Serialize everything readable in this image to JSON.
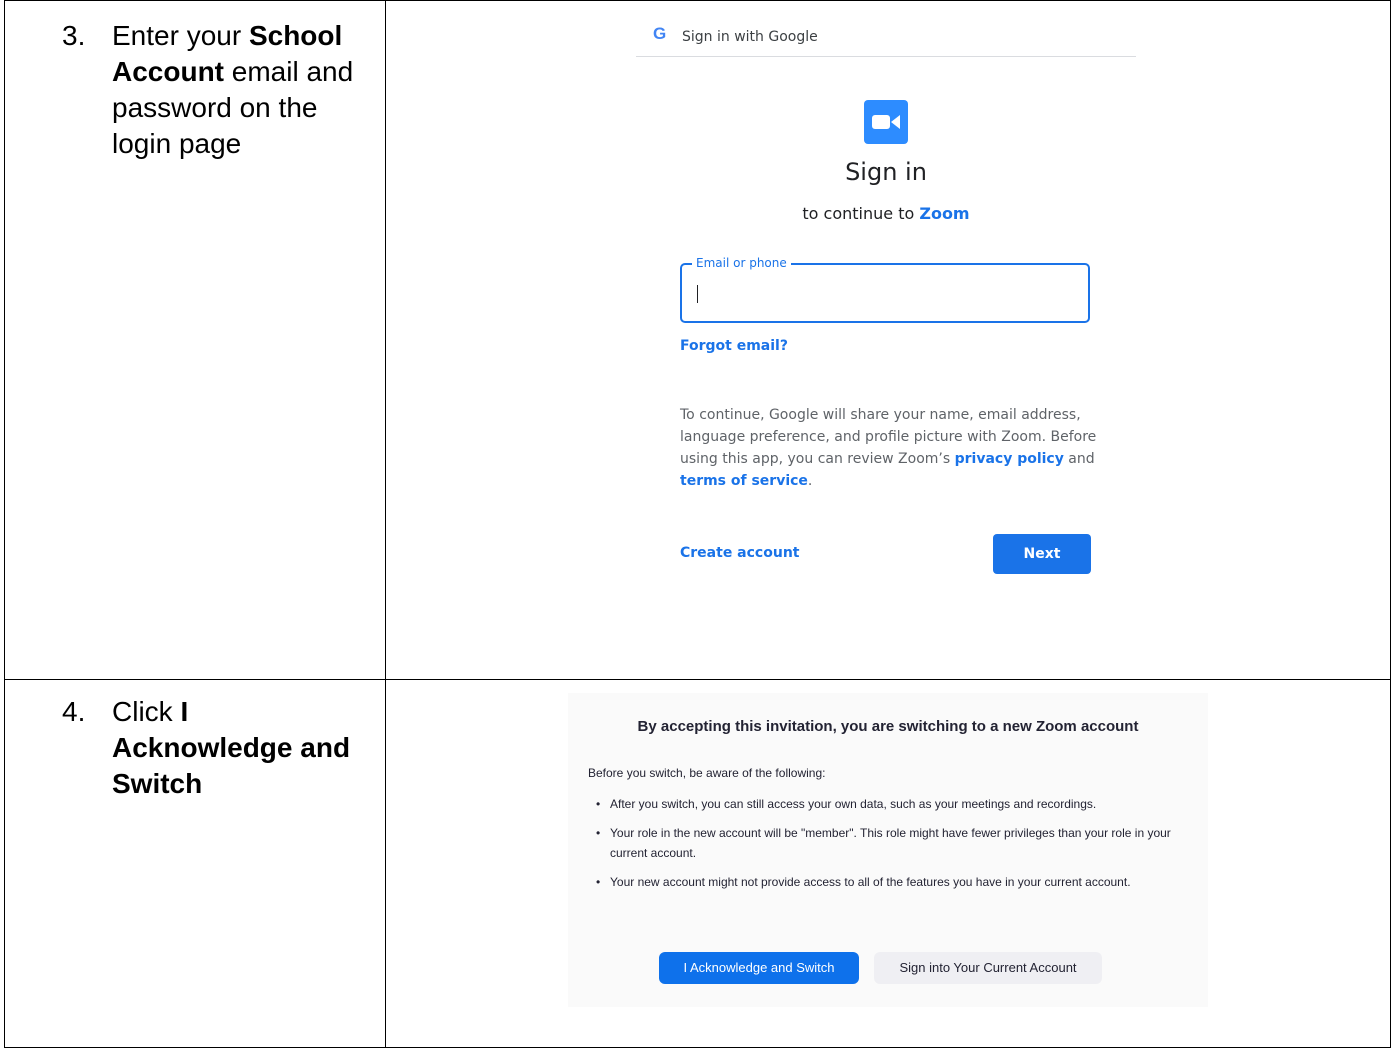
{
  "steps": [
    {
      "number": "3.",
      "parts": [
        "Enter your ",
        "School Account",
        " email and password on the login page"
      ]
    },
    {
      "number": "4.",
      "parts": [
        "Click ",
        "I Acknowledge and Switch"
      ]
    }
  ],
  "google": {
    "logo": "G",
    "header": "Sign in with Google",
    "title": "Sign in",
    "subtitle_prefix": "to continue to ",
    "subtitle_app": "Zoom",
    "email_label": "Email or phone",
    "forgot": "Forgot email?",
    "consent_1": "To continue, Google will share your name, email address, language preference, and profile picture with Zoom. Before using this app, you can review Zoom’s ",
    "privacy": "privacy policy",
    "consent_2": " and ",
    "terms": "terms of service",
    "consent_3": ".",
    "create": "Create account",
    "next": "Next"
  },
  "zoom": {
    "title": "By accepting this invitation, you are switching to a new Zoom account",
    "intro": "Before you switch, be aware of the following:",
    "bullets": [
      "After you switch, you can still access your own data, such as your meetings and recordings.",
      "Your role in the new account will be \"member\". This role might have fewer privileges than your role in your current account.",
      "Your new account might not provide access to all of the features you have in your current account."
    ],
    "bullet_glyph": "•",
    "acknowledge": "I Acknowledge and Switch",
    "signin_current": "Sign into Your Current Account"
  },
  "colors": {
    "google_blue": "#1a73e8",
    "zoom_blue": "#0e71eb",
    "zoom_icon": "#2d8cff"
  },
  "icons": {
    "google_logo": "google-g-icon",
    "zoom_app": "zoom-video-icon"
  }
}
